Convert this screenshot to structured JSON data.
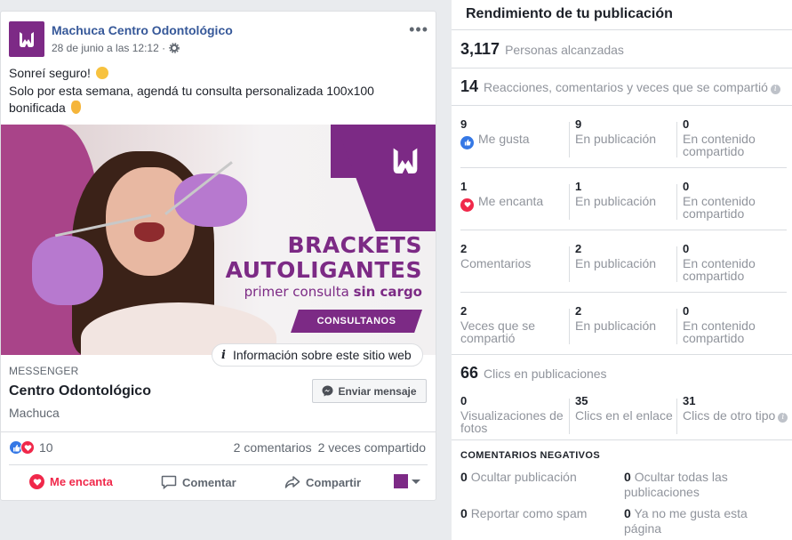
{
  "post": {
    "page_name": "Machuca Centro Odontológico",
    "timestamp": "28 de junio a las 12:12 ·",
    "text_line1": "Sonreí seguro!",
    "text_line2": "Solo por esta semana, agendá tu consulta personalizada 100x100",
    "text_line3": "bonificada",
    "ad": {
      "headline1": "BRACKETS",
      "headline2": "AUTOLIGANTES",
      "subline_regular": "primer consulta",
      "subline_bold": "sin cargo",
      "cta": "CONSULTANOS",
      "site_info": "Información sobre este sitio web"
    },
    "link": {
      "source_label": "MESSENGER",
      "title": "Centro Odontológico",
      "subtitle": "Machuca",
      "send_button": "Enviar mensaje"
    },
    "reactions_count": "10",
    "comments": "2 comentarios",
    "shares": "2 veces compartido",
    "actions": {
      "love": "Me encanta",
      "comment": "Comentar",
      "share": "Compartir"
    }
  },
  "insights": {
    "title": "Rendimiento de tu publicación",
    "reach": {
      "value": "3,117",
      "label": "Personas alcanzadas"
    },
    "engagement": {
      "value": "14",
      "label": "Reacciones, comentarios y veces que se compartió"
    },
    "rows": [
      {
        "total": "9",
        "label": "Me gusta",
        "on_post": "9",
        "on_post_label": "En publicación",
        "shared": "0",
        "shared_label": "En contenido compartido"
      },
      {
        "total": "1",
        "label": "Me encanta",
        "on_post": "1",
        "on_post_label": "En publicación",
        "shared": "0",
        "shared_label": "En contenido compartido"
      },
      {
        "total": "2",
        "label": "Comentarios",
        "on_post": "2",
        "on_post_label": "En publicación",
        "shared": "0",
        "shared_label": "En contenido compartido"
      },
      {
        "total": "2",
        "label": "Veces que se compartió",
        "on_post": "2",
        "on_post_label": "En publicación",
        "shared": "0",
        "shared_label": "En contenido compartido"
      }
    ],
    "clicks": {
      "value": "66",
      "label": "Clics en publicaciones",
      "photo_views": "0",
      "photo_views_label": "Visualizaciones de fotos",
      "link_clicks": "35",
      "link_clicks_label": "Clics en el enlace",
      "other_clicks": "31",
      "other_clicks_label": "Clics de otro tipo"
    },
    "negative": {
      "title": "COMENTARIOS NEGATIVOS",
      "hide_post": {
        "value": "0",
        "label": "Ocultar publicación"
      },
      "hide_all": {
        "value": "0",
        "label": "Ocultar todas las publicaciones"
      },
      "report_spam": {
        "value": "0",
        "label": "Reportar como spam"
      },
      "unlike_page": {
        "value": "0",
        "label": "Ya no me gusta esta página"
      }
    }
  },
  "colors": {
    "brand_purple": "#7c2a85",
    "facebook_link": "#365899",
    "love_red": "#f0284a",
    "like_blue": "#3578e5"
  }
}
